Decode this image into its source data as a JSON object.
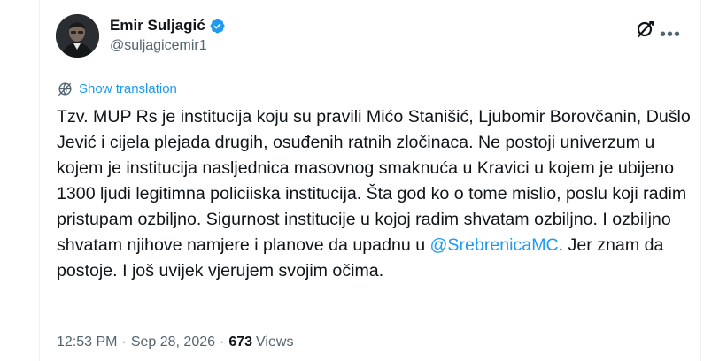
{
  "author": {
    "name": "Emir Suljagić",
    "handle": "@suljagicemir1",
    "verified_color": "#1d9bf0"
  },
  "actions": {
    "grok_icon": "slashed-circle-icon",
    "more_icon": "ellipsis-icon"
  },
  "translate": {
    "label": "Show translation",
    "icon": "globe-icon"
  },
  "tweet": {
    "text_part1": "Tzv. MUP Rs je institucija koju su pravili Mićo Stanišić, Ljubomir Borovčanin, Dušlo Jević i cijela plejada drugih, osuđenih ratnih zločinaca. Ne postoji univerzum u kojem je institucija nasljednica masovnog smaknuća u Kravici u kojem je ubijeno 1300 ljudi legitimna policiiska institucija. Šta god ko o tome mislio, poslu koji radim pristupam ozbiljno. Sigurnost institucije u kojoj radim shvatam ozbiljno. I ozbiljno shvatam njihove namjere i planove da upadnu u ",
    "mention": "@SrebrenicaMC",
    "text_part2": ". Jer znam da postoje. I još uvijek vjerujem svojim očima."
  },
  "meta": {
    "time": "12:53 PM",
    "separator": "·",
    "date": "Sep 28, 2026",
    "views_count": "673",
    "views_label": "Views"
  },
  "colors": {
    "accent": "#1d9bf0",
    "text": "#0f1419",
    "secondary": "#536471"
  }
}
